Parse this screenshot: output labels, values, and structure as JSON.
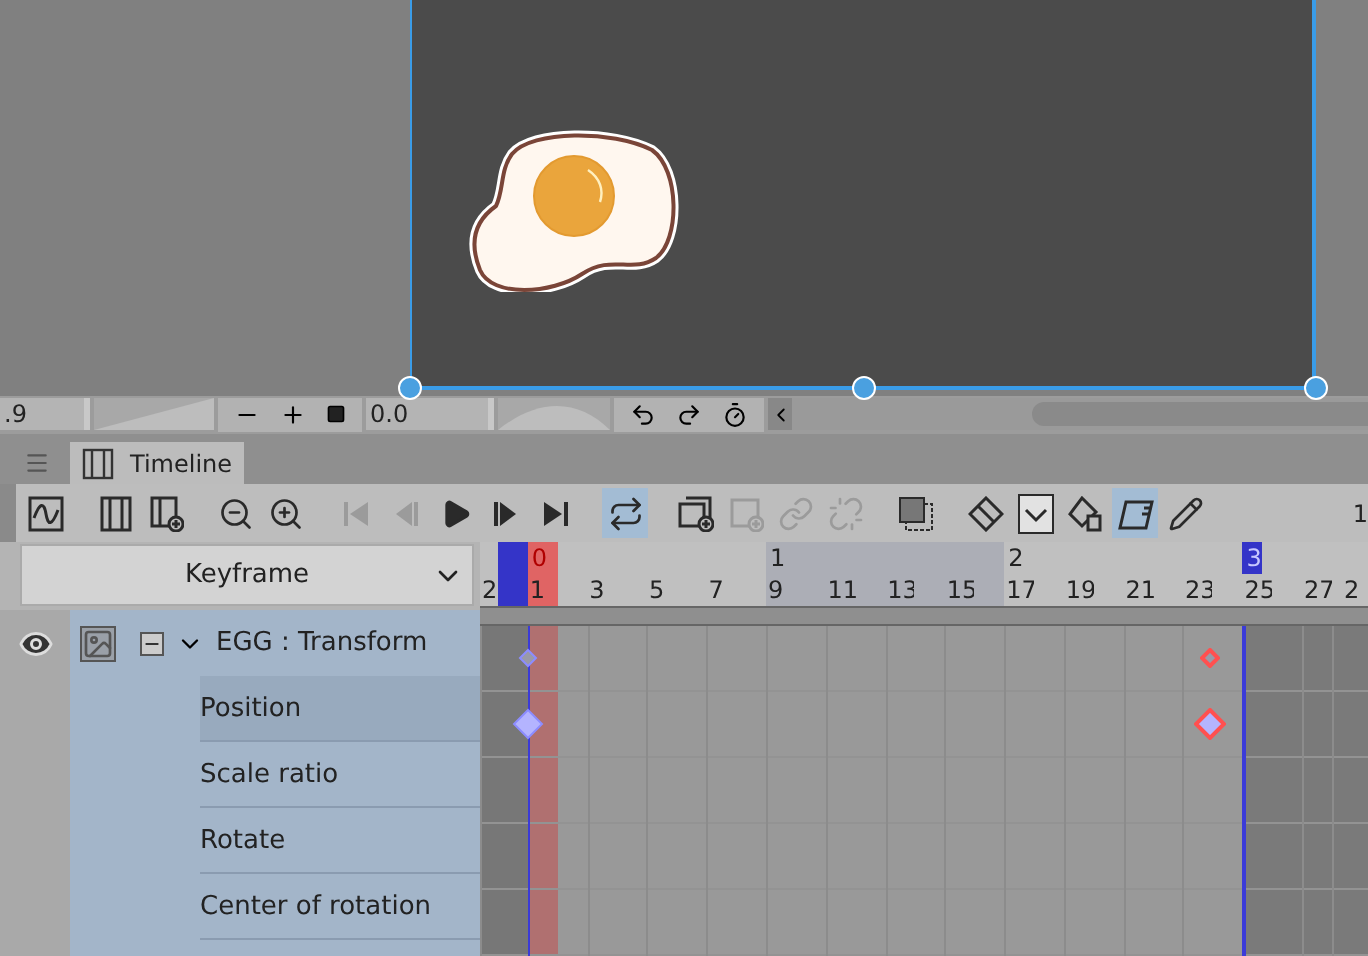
{
  "canvas_bar": {
    "zoom_value": ".9",
    "angle_value": "0.0"
  },
  "tabs": [
    {
      "label": "Timeline",
      "selected": true
    }
  ],
  "toolbar": {
    "groups": [
      [
        {
          "kind": "graph",
          "selected": false,
          "disabled": false
        }
      ],
      [
        {
          "kind": "frames",
          "selected": false,
          "disabled": false
        },
        {
          "kind": "frames-add",
          "selected": false,
          "disabled": false
        }
      ],
      [
        {
          "kind": "zoom-out",
          "selected": false,
          "disabled": false
        },
        {
          "kind": "zoom-in",
          "selected": false,
          "disabled": false
        }
      ],
      [
        {
          "kind": "first",
          "selected": false,
          "disabled": true
        },
        {
          "kind": "prev",
          "selected": false,
          "disabled": true
        },
        {
          "kind": "play",
          "selected": false,
          "disabled": false
        },
        {
          "kind": "next",
          "selected": false,
          "disabled": false
        },
        {
          "kind": "last",
          "selected": false,
          "disabled": false
        }
      ],
      [
        {
          "kind": "loop",
          "selected": true,
          "disabled": false
        }
      ],
      [
        {
          "kind": "new-frame",
          "selected": false,
          "disabled": false
        },
        {
          "kind": "new-cel",
          "selected": false,
          "disabled": true
        },
        {
          "kind": "link",
          "selected": false,
          "disabled": true
        },
        {
          "kind": "unlink",
          "selected": false,
          "disabled": true
        }
      ],
      [
        {
          "kind": "onion",
          "selected": false,
          "disabled": false
        }
      ],
      [
        {
          "kind": "transform",
          "selected": false,
          "disabled": false
        },
        {
          "kind": "dropdown",
          "selected": false,
          "disabled": false
        },
        {
          "kind": "delete-key",
          "selected": false,
          "disabled": false
        },
        {
          "kind": "camera",
          "selected": true,
          "disabled": false
        },
        {
          "kind": "pen",
          "selected": false,
          "disabled": false
        }
      ]
    ],
    "edge_text": "1"
  },
  "keyframe_dropdown": {
    "value": "Keyframe"
  },
  "timeline": {
    "frames": [
      {
        "kind": "before",
        "label": "2"
      },
      {
        "kind": "start"
      },
      {
        "kind": "current",
        "label": "1",
        "second": "0",
        "keys": [
          {
            "selected": false
          },
          {
            "selected": false
          }
        ]
      },
      {
        "kind": "plain"
      },
      {
        "kind": "plain",
        "label": "3"
      },
      {
        "kind": "plain"
      },
      {
        "kind": "plain",
        "label": "5"
      },
      {
        "kind": "plain"
      },
      {
        "kind": "plain",
        "label": "7"
      },
      {
        "kind": "plain"
      },
      {
        "kind": "shaded",
        "label": "9",
        "second": "1"
      },
      {
        "kind": "shaded"
      },
      {
        "kind": "shaded",
        "label": "11"
      },
      {
        "kind": "shaded"
      },
      {
        "kind": "shaded",
        "label": "13"
      },
      {
        "kind": "shaded"
      },
      {
        "kind": "shaded",
        "label": "15"
      },
      {
        "kind": "shaded"
      },
      {
        "kind": "plain",
        "label": "17",
        "second": "2"
      },
      {
        "kind": "plain"
      },
      {
        "kind": "plain",
        "label": "19"
      },
      {
        "kind": "plain"
      },
      {
        "kind": "plain",
        "label": "21"
      },
      {
        "kind": "plain"
      },
      {
        "kind": "plain",
        "label": "23"
      },
      {
        "kind": "plain",
        "keys": [
          {
            "selected": true
          },
          {
            "selected": true
          }
        ]
      },
      {
        "kind": "end",
        "label": "25",
        "second": "3"
      },
      {
        "kind": "after"
      },
      {
        "kind": "after",
        "label": "27"
      },
      {
        "kind": "after",
        "label": "2"
      }
    ]
  },
  "layers": [
    {
      "name": "EGG : Transform",
      "visible": true,
      "expanded": true,
      "selected": false,
      "children": [
        {
          "name": "Position",
          "selected": true
        },
        {
          "name": "Scale ratio",
          "selected": false
        },
        {
          "name": "Rotate",
          "selected": false
        },
        {
          "name": "Center of rotation",
          "selected": false
        }
      ]
    }
  ]
}
